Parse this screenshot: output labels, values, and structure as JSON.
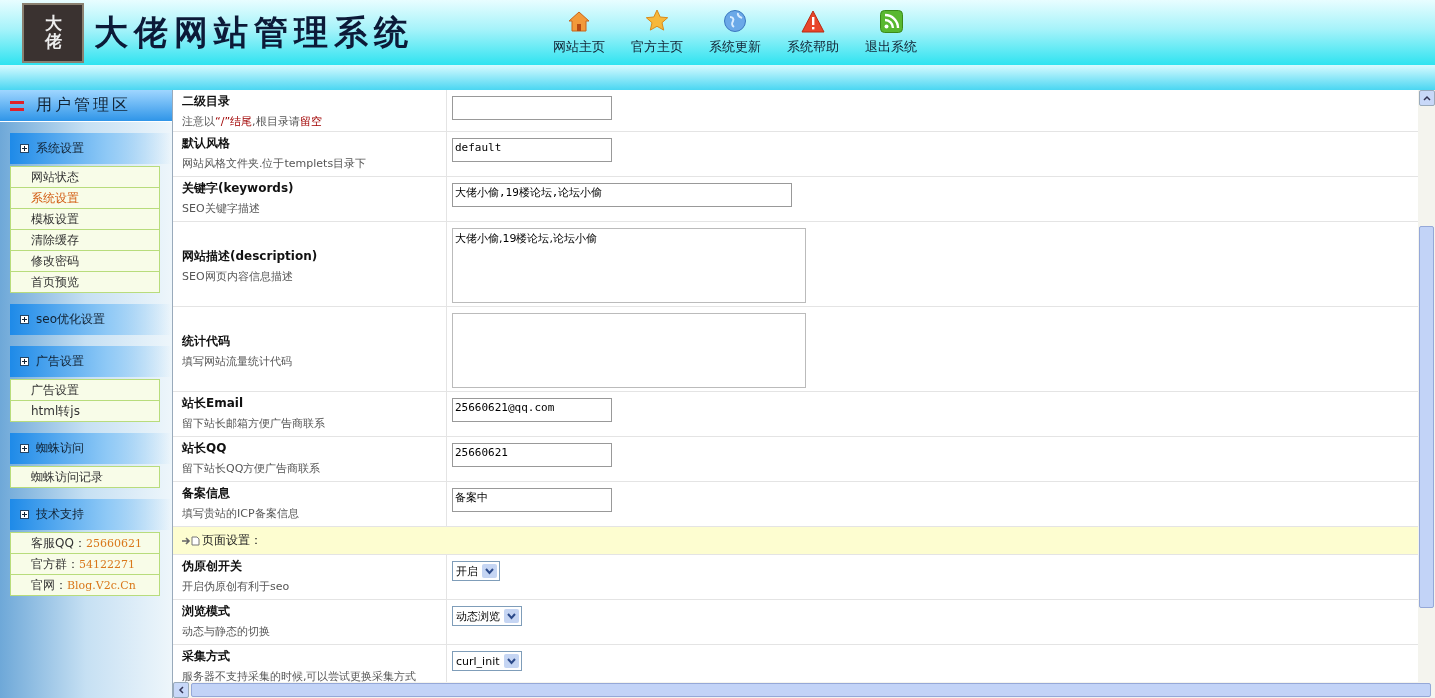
{
  "header": {
    "logo_text": "大佬",
    "title": "大佬网站管理系统",
    "nav": [
      {
        "label": "网站主页"
      },
      {
        "label": "官方主页"
      },
      {
        "label": "系统更新"
      },
      {
        "label": "系统帮助"
      },
      {
        "label": "退出系统"
      }
    ]
  },
  "sidebar": {
    "title": "用户管理区",
    "groups": [
      {
        "title": "系统设置",
        "items": [
          {
            "label": "网站状态",
            "selected": false
          },
          {
            "label": "系统设置",
            "selected": true
          },
          {
            "label": "模板设置",
            "selected": false
          },
          {
            "label": "清除缓存",
            "selected": false
          },
          {
            "label": "修改密码",
            "selected": false
          },
          {
            "label": "首页预览",
            "selected": false
          }
        ]
      },
      {
        "title": "seo优化设置"
      },
      {
        "title": "广告设置",
        "items": [
          {
            "label": "广告设置",
            "selected": false
          },
          {
            "label": "html转js",
            "selected": false
          }
        ]
      },
      {
        "title": "蜘蛛访问",
        "items": [
          {
            "label": "蜘蛛访问记录",
            "selected": false
          }
        ]
      },
      {
        "title": "技术支持",
        "items": [
          {
            "label": "客服QQ：",
            "value": "25660621",
            "selected": false
          },
          {
            "label": "官方群：",
            "value": "54122271",
            "selected": false
          },
          {
            "label": "官网：",
            "value": "Blog.V2c.Cn",
            "selected": false
          }
        ]
      }
    ]
  },
  "form": [
    {
      "kind": "field",
      "label": "二级目录",
      "hint": "注意以**“/”结尾**,根目录请**留空**",
      "control": {
        "kind": "input"
      }
    },
    {
      "kind": "field",
      "label": "默认风格",
      "hint": "网站风格文件夹.位于templets目录下",
      "control": {
        "kind": "input",
        "value": "default"
      }
    },
    {
      "kind": "field",
      "label": "关键字(keywords)",
      "hint": "SEO关键字描述",
      "control": {
        "kind": "wide-input",
        "value": "大佬小偷,19楼论坛,论坛小偷"
      }
    },
    {
      "kind": "tall",
      "label": "网站描述(description)",
      "hint": "SEO网页内容信息描述",
      "control": {
        "kind": "textarea",
        "value": "大佬小偷,19楼论坛,论坛小偷"
      }
    },
    {
      "kind": "tall",
      "label": "统计代码",
      "hint": "填写网站流量统计代码",
      "control": {
        "kind": "textarea"
      }
    },
    {
      "kind": "field",
      "label": "站长Email",
      "hint": "留下站长邮箱方便广告商联系",
      "control": {
        "kind": "input",
        "value": "25660621@qq.com"
      }
    },
    {
      "kind": "field",
      "label": "站长QQ",
      "hint": "留下站长QQ方便广告商联系",
      "control": {
        "kind": "input",
        "value": "25660621"
      }
    },
    {
      "kind": "field",
      "label": "备案信息",
      "hint": "填写贵站的ICP备案信息",
      "control": {
        "kind": "input",
        "value": "备案中"
      }
    },
    {
      "kind": "section",
      "label": "页面设置："
    },
    {
      "kind": "field",
      "label": "伪原创开关",
      "hint": "开启伪原创有利于seo",
      "control": {
        "kind": "select",
        "value": "开启"
      }
    },
    {
      "kind": "field",
      "label": "浏览模式",
      "hint": "动态与静态的切换",
      "control": {
        "kind": "select",
        "value": "动态浏览"
      }
    },
    {
      "kind": "field",
      "label": "采集方式",
      "hint": "服务器不支持采集的时候,可以尝试更换采集方式",
      "control": {
        "kind": "select",
        "value": "curl_init"
      }
    }
  ]
}
